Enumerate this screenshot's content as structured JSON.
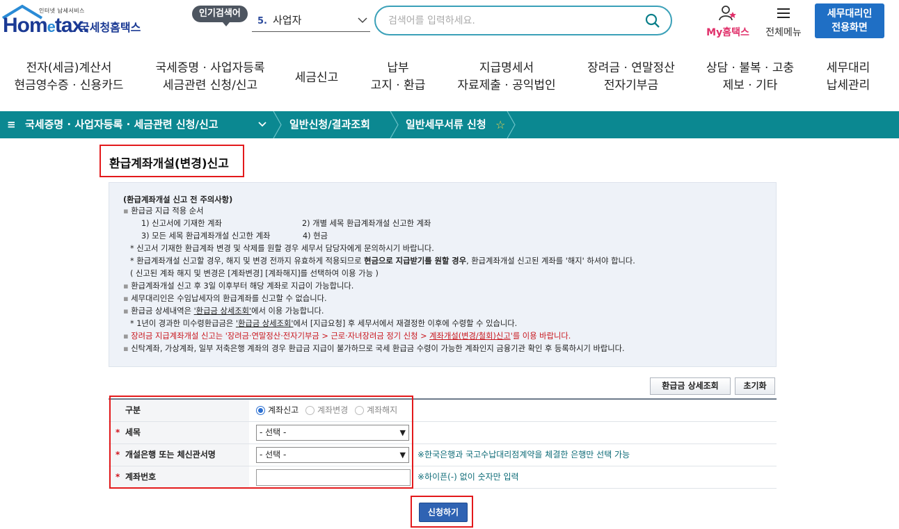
{
  "header": {
    "logo_small": "인터넷 납세서비스",
    "logo_main_1": "Hom",
    "logo_main_e": "e",
    "logo_main_2": "tax.",
    "logo_kor": "국세청홈택스",
    "popular_tag": "인기검색어",
    "popular_num": "5.",
    "popular_term": "사업자",
    "search_placeholder": "검색어를 입력하세요.",
    "my_hometax": "My홈택스",
    "all_menu": "전체메뉴",
    "agent_line1": "세무대리인",
    "agent_line2": "전용화면"
  },
  "gnb": [
    {
      "l1": "전자(세금)계산서",
      "l2": "현금영수증 · 신용카드"
    },
    {
      "l1": "국세증명 · 사업자등록",
      "l2": "세금관련 신청/신고"
    },
    {
      "l1": "세금신고",
      "l2": ""
    },
    {
      "l1": "납부",
      "l2": "고지 · 환급"
    },
    {
      "l1": "지급명세서",
      "l2": "자료제출 · 공익법인"
    },
    {
      "l1": "장려금 · 연말정산",
      "l2": "전자기부금"
    },
    {
      "l1": "상담 · 불복 · 고충",
      "l2": "제보 · 기타"
    },
    {
      "l1": "세무대리",
      "l2": "납세관리"
    }
  ],
  "breadcrumb": {
    "menu_icon": "≡",
    "c1": "국세증명 · 사업자등록 · 세금관련 신청/신고",
    "c2": "일반신청/결과조회",
    "c3": "일반세무서류 신청",
    "star": "☆"
  },
  "page_title": "환급계좌개설(변경)신고",
  "notice": {
    "head": "(환급계좌개설 신고 전 주의사항)",
    "l1": "환급금 지급 적용 순서",
    "l2a": "1) 신고서에 기재한 계좌",
    "l2b": "2) 개별 세목 환급계좌개설 신고한 계좌",
    "l3a": "3) 모든 세목 환급계좌개설 신고한 계좌",
    "l3b": "4) 현금",
    "l4": "* 신고서 기재한 환급계좌 변경 및 삭제를 원할 경우 세무서 담당자에게 문의하시기 바랍니다.",
    "l5a": "* 환급계좌개설 신고할 경우, 해지 및 변경 전까지 유효하게 적용되므로 ",
    "l5b": "현금으로 지급받기를 원할 경우",
    "l5c": ", 환급계좌개설 신고된 계좌를 '해지' 하셔야 합니다.",
    "l6": "( 신고된 계좌 해지 및 변경은 [계좌변경] [계좌해지]를 선택하여 이용 가능 )",
    "l7": "환급계좌개설 신고 후 3일 이후부터 해당 계좌로 지급이 가능합니다.",
    "l8": "세무대리인은 수임납세자의 환급계좌를 신고할 수 없습니다.",
    "l9a": "환급금 상세내역은 ",
    "l9b": "'환급금 상세조회'",
    "l9c": "에서 이용 가능합니다.",
    "l10a": "* 1년이 경과한 미수령환급금은 ",
    "l10b": "'환급금 상세조회'",
    "l10c": "에서 [지급요청] 후 세무서에서 재결정한 이후에 수령할 수 있습니다.",
    "l11a": "장려금 지급계좌개설 신고는 '장려금·연말정산·전자기부금 > 근로·자녀장려금 정기 신청 > ",
    "l11b": "계좌개설(변경/철회)신고",
    "l11c": "'를 이용 바랍니다.",
    "l12": "신탁계좌, 가상계좌, 일부 저축은행 계좌의 경우 환급금 지급이 불가하므로 국세 환급금 수령이 가능한 계좌인지 금융기관 확인 후 등록하시기 바랍니다."
  },
  "buttons": {
    "refund_detail": "환급금 상세조회",
    "reset": "초기화",
    "submit": "신청하기"
  },
  "form": {
    "row1_label": "구분",
    "radio1": "계좌신고",
    "radio2": "계좌변경",
    "radio3": "계좌해지",
    "row2_label": "세목",
    "row2_select": "- 선택 -",
    "row3_label": "개설은행 또는 체신관서명",
    "row3_select": "- 선택 -",
    "row3_hint": "※한국은행과 국고수납대리점계약을 체결한 은행만 선택 가능",
    "row4_label": "계좌번호",
    "row4_hint": "※하이픈(-) 없이 숫자만 입력",
    "required_mark": "*"
  },
  "colors": {
    "brand_blue": "#1b3a94",
    "teal_bar": "#0b8891",
    "highlight_red": "#e3191b",
    "agent_button": "#1f6fc5"
  }
}
